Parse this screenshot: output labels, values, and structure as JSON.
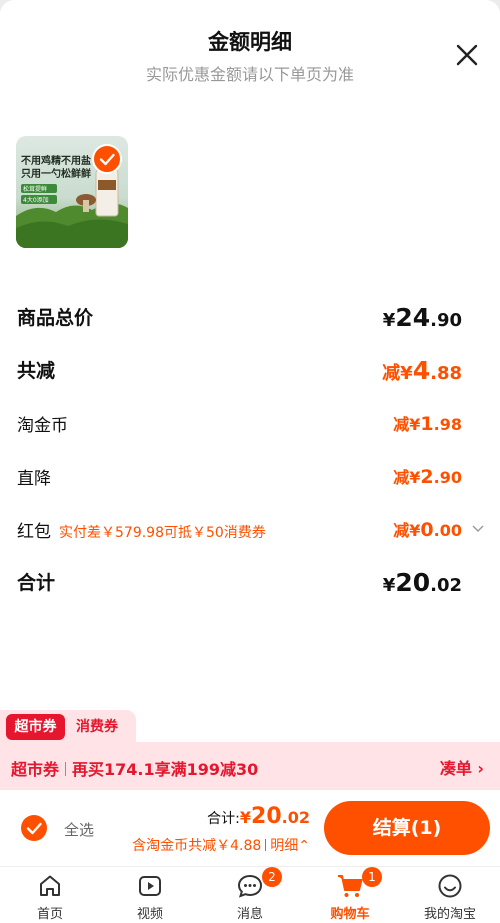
{
  "header": {
    "title": "金额明细",
    "subtitle": "实际优惠金额请以下单页为准"
  },
  "product": {
    "image_text_line1": "不用鸡精不用盐",
    "image_text_line2": "只用一勺松鲜鲜",
    "image_tag1": "松茸提鲜",
    "image_tag2": "4大0添加",
    "selected": true
  },
  "breakdown": {
    "total_price": {
      "label": "商品总价",
      "symbol": "¥",
      "int": "24",
      "dec": ".90"
    },
    "total_reduce": {
      "label": "共减",
      "prefix": "减",
      "symbol": "¥",
      "int": "4",
      "dec": ".88"
    },
    "coins": {
      "label": "淘金币",
      "prefix": "减",
      "symbol": "¥",
      "int": "1",
      "dec": ".98"
    },
    "direct": {
      "label": "直降",
      "prefix": "减",
      "symbol": "¥",
      "int": "2",
      "dec": ".90"
    },
    "redpacket": {
      "label": "红包",
      "note": "实付差￥579.98可抵￥50消费券",
      "prefix": "减",
      "symbol": "¥",
      "int": "0",
      "dec": ".00"
    },
    "sum": {
      "label": "合计",
      "symbol": "¥",
      "int": "20",
      "dec": ".02"
    }
  },
  "coupon": {
    "tab_super": "超市券",
    "tab_consume": "消费券",
    "bar_left": "超市券",
    "bar_text": "再买174.1享满199减30",
    "bar_action": "凑单 ›"
  },
  "footer": {
    "select_all": "全选",
    "total_label": "合计:",
    "total_symbol": "¥",
    "total_int": "20",
    "total_dec": ".02",
    "discount_text": "含淘金币共减￥4.88",
    "detail_link": "明细⌃",
    "checkout": "结算(1)"
  },
  "tabbar": [
    {
      "label": "首页",
      "icon": "home-icon"
    },
    {
      "label": "视频",
      "icon": "video-icon"
    },
    {
      "label": "消息",
      "icon": "message-icon",
      "badge": "2"
    },
    {
      "label": "购物车",
      "icon": "cart-icon",
      "badge": "1",
      "active": true
    },
    {
      "label": "我的淘宝",
      "icon": "profile-icon"
    }
  ],
  "colors": {
    "accent": "#ff5000",
    "coupon_red": "#e5162d",
    "coupon_bg": "#ffe3e6"
  }
}
